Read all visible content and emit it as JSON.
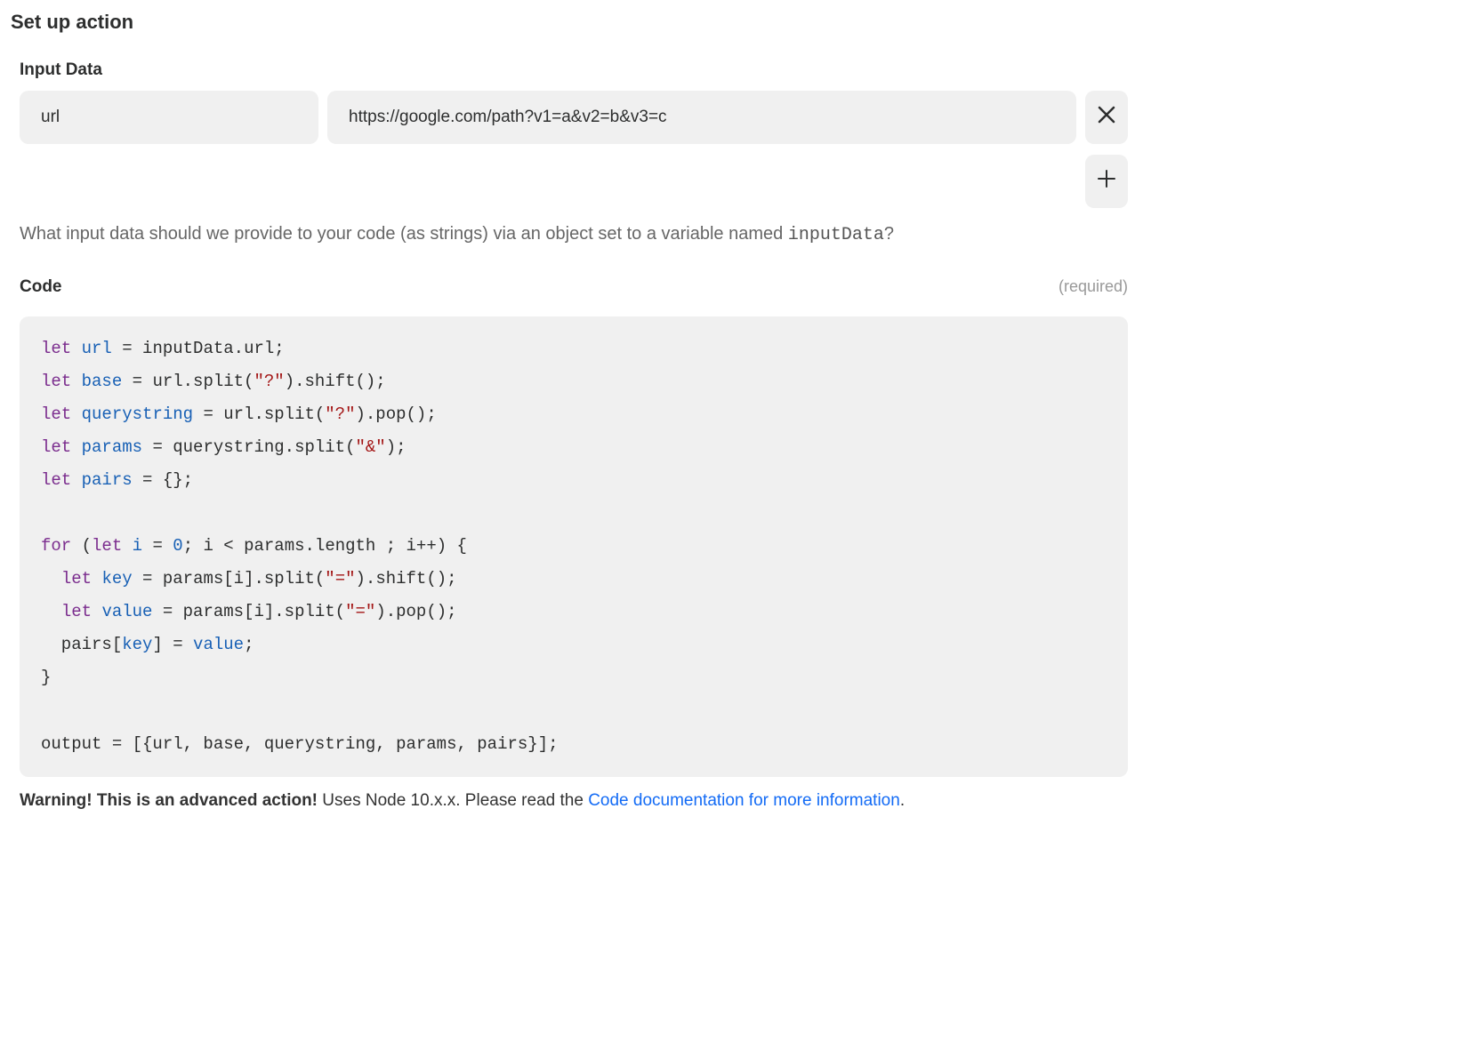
{
  "title": "Set up action",
  "inputData": {
    "label": "Input Data",
    "rows": [
      {
        "key": "url",
        "value": "https://google.com/path?v1=a&v2=b&v3=c"
      }
    ],
    "helperPrefix": "What input data should we provide to your code (as strings) via an object set to a variable named ",
    "helperCode": "inputData",
    "helperSuffix": "?"
  },
  "code": {
    "label": "Code",
    "requiredLabel": "(required)",
    "tokens": [
      {
        "t": "kw",
        "v": "let"
      },
      {
        "t": "",
        "v": " "
      },
      {
        "t": "var",
        "v": "url"
      },
      {
        "t": "",
        "v": " = inputData.url;\n"
      },
      {
        "t": "kw",
        "v": "let"
      },
      {
        "t": "",
        "v": " "
      },
      {
        "t": "var",
        "v": "base"
      },
      {
        "t": "",
        "v": " = url.split("
      },
      {
        "t": "str",
        "v": "\"?\""
      },
      {
        "t": "",
        "v": ").shift();\n"
      },
      {
        "t": "kw",
        "v": "let"
      },
      {
        "t": "",
        "v": " "
      },
      {
        "t": "var",
        "v": "querystring"
      },
      {
        "t": "",
        "v": " = url.split("
      },
      {
        "t": "str",
        "v": "\"?\""
      },
      {
        "t": "",
        "v": ").pop();\n"
      },
      {
        "t": "kw",
        "v": "let"
      },
      {
        "t": "",
        "v": " "
      },
      {
        "t": "var",
        "v": "params"
      },
      {
        "t": "",
        "v": " = querystring.split("
      },
      {
        "t": "str",
        "v": "\"&\""
      },
      {
        "t": "",
        "v": ");\n"
      },
      {
        "t": "kw",
        "v": "let"
      },
      {
        "t": "",
        "v": " "
      },
      {
        "t": "var",
        "v": "pairs"
      },
      {
        "t": "",
        "v": " = {};\n"
      },
      {
        "t": "",
        "v": "\n"
      },
      {
        "t": "kw",
        "v": "for"
      },
      {
        "t": "",
        "v": " ("
      },
      {
        "t": "kw",
        "v": "let"
      },
      {
        "t": "",
        "v": " "
      },
      {
        "t": "var",
        "v": "i"
      },
      {
        "t": "",
        "v": " = "
      },
      {
        "t": "num",
        "v": "0"
      },
      {
        "t": "",
        "v": "; i < params.length ; i++) {\n"
      },
      {
        "t": "",
        "v": "  "
      },
      {
        "t": "kw",
        "v": "let"
      },
      {
        "t": "",
        "v": " "
      },
      {
        "t": "var",
        "v": "key"
      },
      {
        "t": "",
        "v": " = params[i].split("
      },
      {
        "t": "str",
        "v": "\"=\""
      },
      {
        "t": "",
        "v": ").shift();\n"
      },
      {
        "t": "",
        "v": "  "
      },
      {
        "t": "kw",
        "v": "let"
      },
      {
        "t": "",
        "v": " "
      },
      {
        "t": "var",
        "v": "value"
      },
      {
        "t": "",
        "v": " = params[i].split("
      },
      {
        "t": "str",
        "v": "\"=\""
      },
      {
        "t": "",
        "v": ").pop();\n"
      },
      {
        "t": "",
        "v": "  pairs["
      },
      {
        "t": "var",
        "v": "key"
      },
      {
        "t": "",
        "v": "] = "
      },
      {
        "t": "var",
        "v": "value"
      },
      {
        "t": "",
        "v": ";\n"
      },
      {
        "t": "",
        "v": "}\n"
      },
      {
        "t": "",
        "v": "\n"
      },
      {
        "t": "",
        "v": "output = [{url, base, querystring, params, pairs}];"
      }
    ]
  },
  "warning": {
    "bold": "Warning! This is an advanced action!",
    "text": " Uses Node 10.x.x. Please read the ",
    "linkText": "Code documentation for more information",
    "suffix": "."
  }
}
